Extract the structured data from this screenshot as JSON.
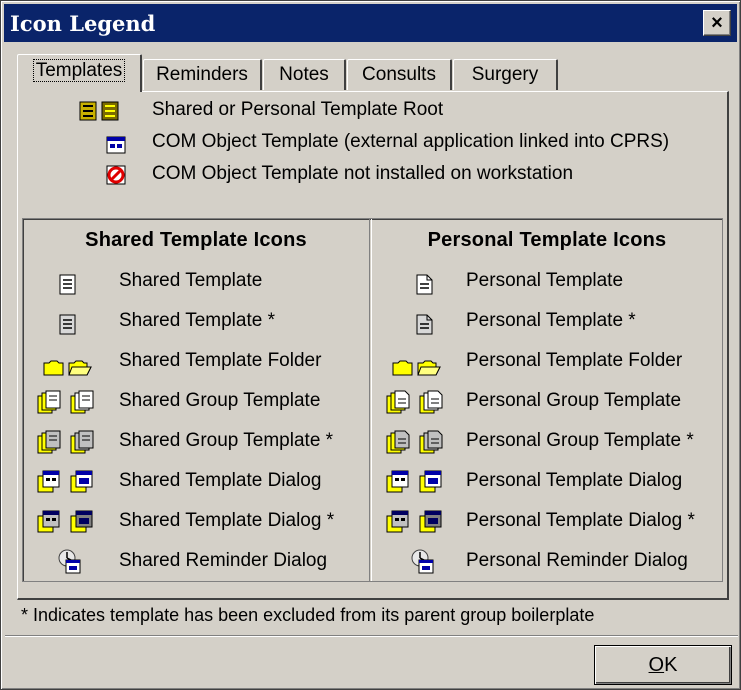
{
  "window": {
    "title": "Icon Legend",
    "close_label": "×"
  },
  "tabs": [
    {
      "label": "Templates",
      "active": true
    },
    {
      "label": "Reminders",
      "active": false
    },
    {
      "label": "Notes",
      "active": false
    },
    {
      "label": "Consults",
      "active": false
    },
    {
      "label": "Surgery",
      "active": false
    }
  ],
  "top_items": [
    {
      "label": "Shared or Personal Template Root",
      "icon": "template-root-icon"
    },
    {
      "label": "COM Object Template (external application linked into CPRS)",
      "icon": "com-object-icon"
    },
    {
      "label": "COM Object Template not installed on workstation",
      "icon": "com-not-installed-icon"
    }
  ],
  "shared": {
    "heading": "Shared Template Icons",
    "items": [
      {
        "label": "Shared Template",
        "icon": "shared-template-icon"
      },
      {
        "label": "Shared Template *",
        "icon": "shared-template-excluded-icon"
      },
      {
        "label": "Shared Template Folder",
        "icon": "shared-folder-icon"
      },
      {
        "label": "Shared Group Template",
        "icon": "shared-group-icon"
      },
      {
        "label": "Shared Group Template *",
        "icon": "shared-group-excluded-icon"
      },
      {
        "label": "Shared Template Dialog",
        "icon": "shared-dialog-icon"
      },
      {
        "label": "Shared Template Dialog *",
        "icon": "shared-dialog-excluded-icon"
      },
      {
        "label": "Shared Reminder Dialog",
        "icon": "shared-reminder-icon"
      }
    ]
  },
  "personal": {
    "heading": "Personal Template Icons",
    "items": [
      {
        "label": "Personal Template",
        "icon": "personal-template-icon"
      },
      {
        "label": "Personal Template *",
        "icon": "personal-template-excluded-icon"
      },
      {
        "label": "Personal Template Folder",
        "icon": "personal-folder-icon"
      },
      {
        "label": "Personal Group Template",
        "icon": "personal-group-icon"
      },
      {
        "label": "Personal Group Template *",
        "icon": "personal-group-excluded-icon"
      },
      {
        "label": "Personal Template Dialog",
        "icon": "personal-dialog-icon"
      },
      {
        "label": "Personal Template Dialog *",
        "icon": "personal-dialog-excluded-icon"
      },
      {
        "label": "Personal Reminder Dialog",
        "icon": "personal-reminder-icon"
      }
    ]
  },
  "footnote": "* Indicates template has been excluded from its parent group boilerplate",
  "ok_button": {
    "mnemonic": "O",
    "rest": "K"
  },
  "colors": {
    "titlebar": "#0a246a",
    "face": "#d4d0c8",
    "folder": "#ffff00",
    "dialog": "#0000a8"
  }
}
